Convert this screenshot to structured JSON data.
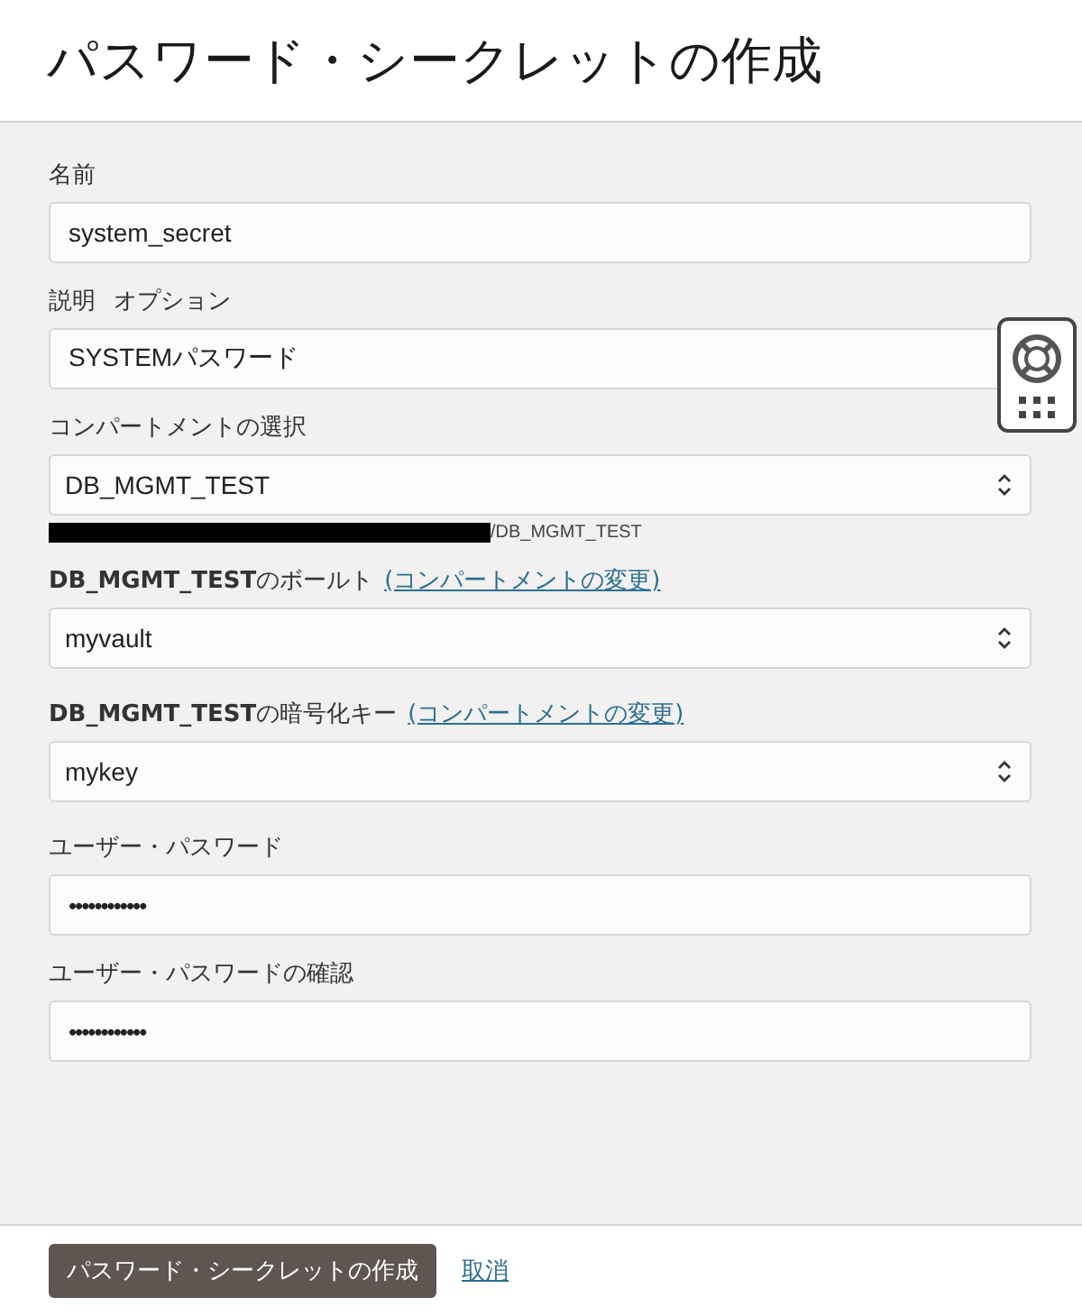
{
  "title": "パスワード・シークレットの作成",
  "fields": [
    {
      "kind": "text",
      "label": "名前",
      "value": "system_secret"
    },
    {
      "kind": "text",
      "label": "説明",
      "optional_tag": "オプション",
      "value": "SYSTEMパスワード"
    },
    {
      "kind": "select",
      "label": "コンパートメントの選択",
      "value": "DB_MGMT_TEST",
      "path": "/DB_MGMT_TEST"
    },
    {
      "kind": "select",
      "label": "**DB_MGMT_TEST**のボールト",
      "link": "(コンパートメントの変更)",
      "value": "myvault"
    },
    {
      "kind": "select",
      "label": "**DB_MGMT_TEST**の暗号化キー",
      "link": "(コンパートメントの変更)",
      "value": "mykey"
    },
    {
      "kind": "password",
      "label": "ユーザー・パスワード",
      "value": "••••••••••••"
    },
    {
      "kind": "password",
      "label": "ユーザー・パスワードの確認",
      "value": "••••••••••••"
    }
  ],
  "footer": {
    "primary_button": "パスワード・シークレットの作成",
    "cancel_link": "取消"
  }
}
